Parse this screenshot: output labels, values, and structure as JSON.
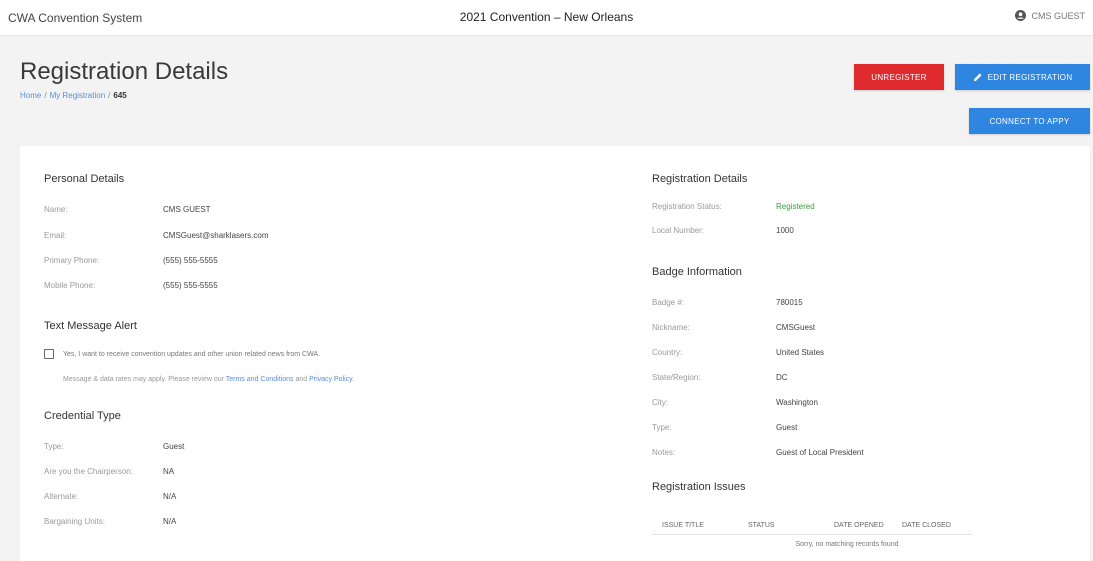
{
  "topbar": {
    "brand": "CWA Convention System",
    "title": "2021 Convention – New Orleans",
    "user": "CMS GUEST"
  },
  "header": {
    "page_title": "Registration Details",
    "breadcrumb": [
      "Home",
      "My Registration",
      "645"
    ],
    "breadcrumb_sep": "/"
  },
  "actions": {
    "unregister": "UNREGISTER",
    "edit_registration": "EDIT REGISTRATION",
    "connect": "CONNECT TO APPY"
  },
  "personal": {
    "title": "Personal Details",
    "rows": [
      {
        "label": "Name:",
        "value": "CMS GUEST"
      },
      {
        "label": "Email:",
        "value": "CMSGuest@sharklasers.com"
      },
      {
        "label": "Primary Phone:",
        "value": "(555) 555-5555"
      },
      {
        "label": "Mobile Phone:",
        "value": "(555) 555-5555"
      }
    ]
  },
  "text_alert": {
    "title": "Text Message Alert",
    "consent": "Yes, I want to receive convention updates and other union related news from CWA.",
    "disclaimer_prefix": "Message & data rates may apply. Please review our",
    "terms_link": "Terms and Conditions",
    "and": "and",
    "privacy_link": "Privacy Policy."
  },
  "credential": {
    "title": "Credential Type",
    "rows": [
      {
        "label": "Type:",
        "value": "Guest"
      },
      {
        "label": "Are you the Chairperson:",
        "value": "NA"
      },
      {
        "label": "Alternate:",
        "value": "N/A"
      },
      {
        "label": "Bargaining Units:",
        "value": "N/A"
      }
    ]
  },
  "registration": {
    "title": "Registration Details",
    "rows": [
      {
        "label": "Registration Status:",
        "value": "Registered"
      },
      {
        "label": "Local Number:",
        "value": "1000"
      }
    ],
    "status_color": "#3a9a3a"
  },
  "badge": {
    "title": "Badge Information",
    "rows": [
      {
        "label": "Badge #:",
        "value": "780015"
      },
      {
        "label": "Nickname:",
        "value": "CMSGuest"
      },
      {
        "label": "Country:",
        "value": "United States"
      },
      {
        "label": "State/Region:",
        "value": "DC"
      },
      {
        "label": "City:",
        "value": "Washington"
      },
      {
        "label": "Type:",
        "value": "Guest"
      },
      {
        "label": "Notes:",
        "value": "Guest of Local President"
      }
    ]
  },
  "issues": {
    "title": "Registration Issues",
    "columns": [
      "Issue Title",
      "Status",
      "Date Opened",
      "Date Closed"
    ],
    "empty": "Sorry, no matching records found"
  },
  "colors": {
    "unregister": "#e02b2e",
    "primary": "#2e86e0",
    "link": "#5b8bd8"
  },
  "icons": {
    "user": "user-circle-icon",
    "edit": "pencil-icon"
  }
}
